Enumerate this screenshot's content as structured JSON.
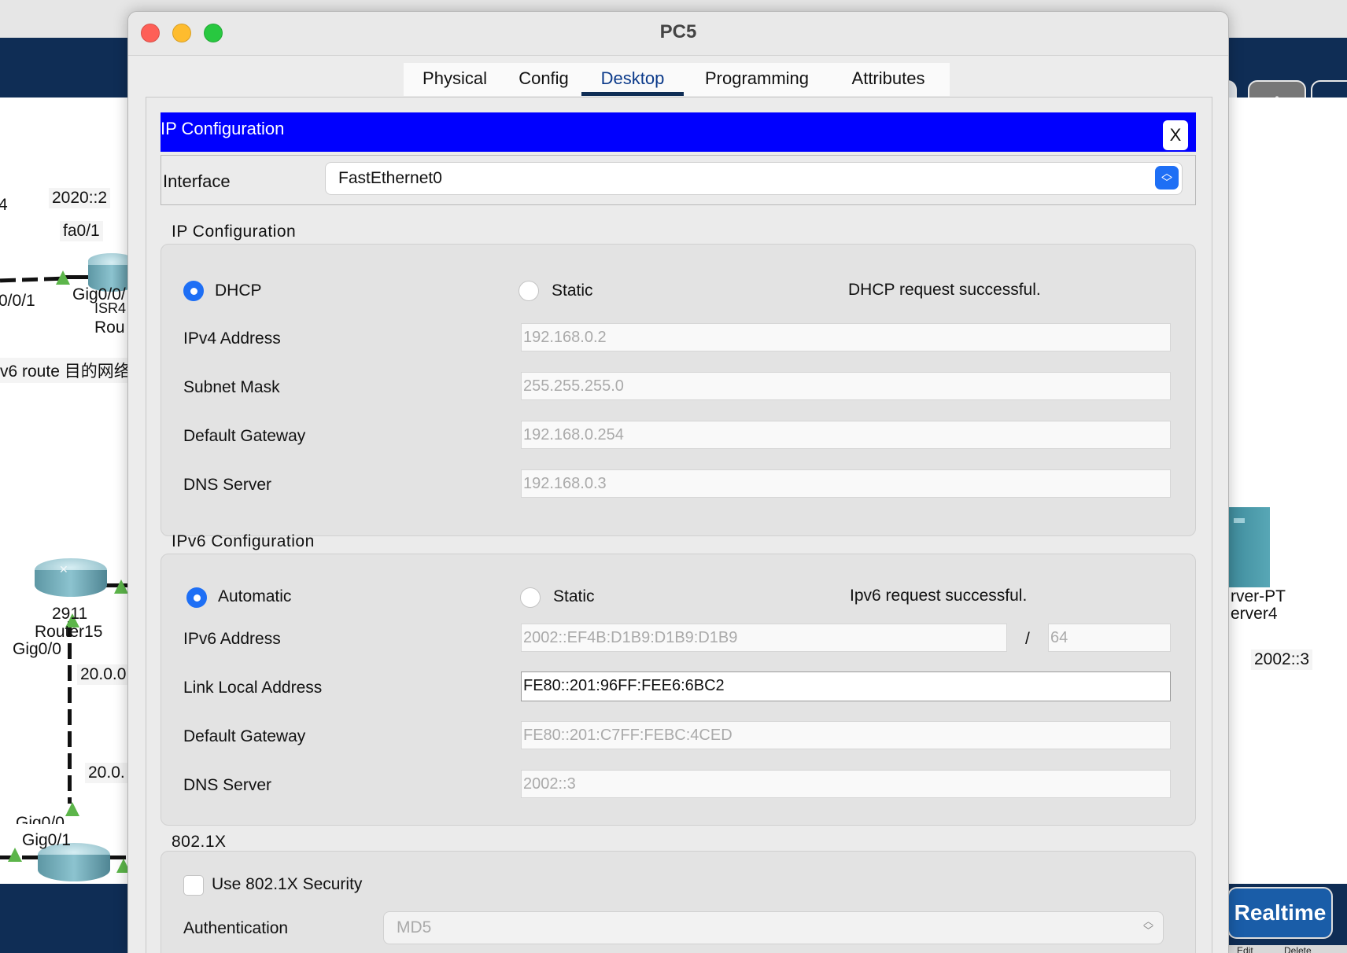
{
  "background": {
    "labels": {
      "edge_4": "4",
      "addr_2020": "2020::2",
      "fa01": "fa0/1",
      "if_001": "0/0/1",
      "gig00_top": "Gig0/0/",
      "isr_model": "ISR4",
      "rou": "Rou",
      "route_note": "v6 route 目的网络",
      "router15_model": "2911",
      "router15_name": "Router15",
      "gig00_left": "Gig0/0",
      "net_20_a": "20.0.0",
      "net_20_b": "20.0.",
      "gig00_bottom": "Gig0/0",
      "gig01_bottom": "Gig0/1",
      "server_type": "rver-PT",
      "server_name": "erver4",
      "server_addr": "2002::3",
      "realtime": "Realtime",
      "edit": "Edit",
      "delete": "Delete"
    }
  },
  "window": {
    "title": "PC5",
    "tabs": [
      "Physical",
      "Config",
      "Desktop",
      "Programming",
      "Attributes"
    ],
    "active_tab": "Desktop"
  },
  "ip_config": {
    "panel_title": "IP Configuration",
    "close_label": "X",
    "interface_label": "Interface",
    "interface_value": "FastEthernet0",
    "ipv4_section": {
      "title": "IP Configuration",
      "dhcp_label": "DHCP",
      "static_label": "Static",
      "mode": "DHCP",
      "status": "DHCP request successful.",
      "ipv4_address_label": "IPv4 Address",
      "ipv4_address": "192.168.0.2",
      "subnet_mask_label": "Subnet Mask",
      "subnet_mask": "255.255.255.0",
      "gateway_label": "Default Gateway",
      "gateway": "192.168.0.254",
      "dns_label": "DNS Server",
      "dns": "192.168.0.3"
    },
    "ipv6_section": {
      "title": "IPv6 Configuration",
      "automatic_label": "Automatic",
      "static_label": "Static",
      "mode": "Automatic",
      "status": "Ipv6 request successful.",
      "ipv6_address_label": "IPv6 Address",
      "ipv6_address": "2002::EF4B:D1B9:D1B9:D1B9",
      "prefix_separator": "/",
      "prefix_length": "64",
      "link_local_label": "Link Local Address",
      "link_local": "FE80::201:96FF:FEE6:6BC2",
      "gateway_label": "Default Gateway",
      "gateway": "FE80::201:C7FF:FEBC:4CED",
      "dns_label": "DNS Server",
      "dns": "2002::3"
    },
    "dot1x_section": {
      "title": "802.1X",
      "use_security_label": "Use 802.1X Security",
      "use_security_checked": false,
      "authentication_label": "Authentication",
      "authentication_value": "MD5"
    }
  },
  "colors": {
    "ipc_bar": "#0000ff",
    "radio_selected": "#1e6ff5",
    "workspace_navy": "#0f2d55",
    "link_marker": "#5cb54a"
  },
  "icons": [
    "close-window-icon",
    "minimize-icon",
    "zoom-icon",
    "dropdown-chevron-icon",
    "router-icon",
    "server-icon",
    "navigation-pad-icon"
  ]
}
